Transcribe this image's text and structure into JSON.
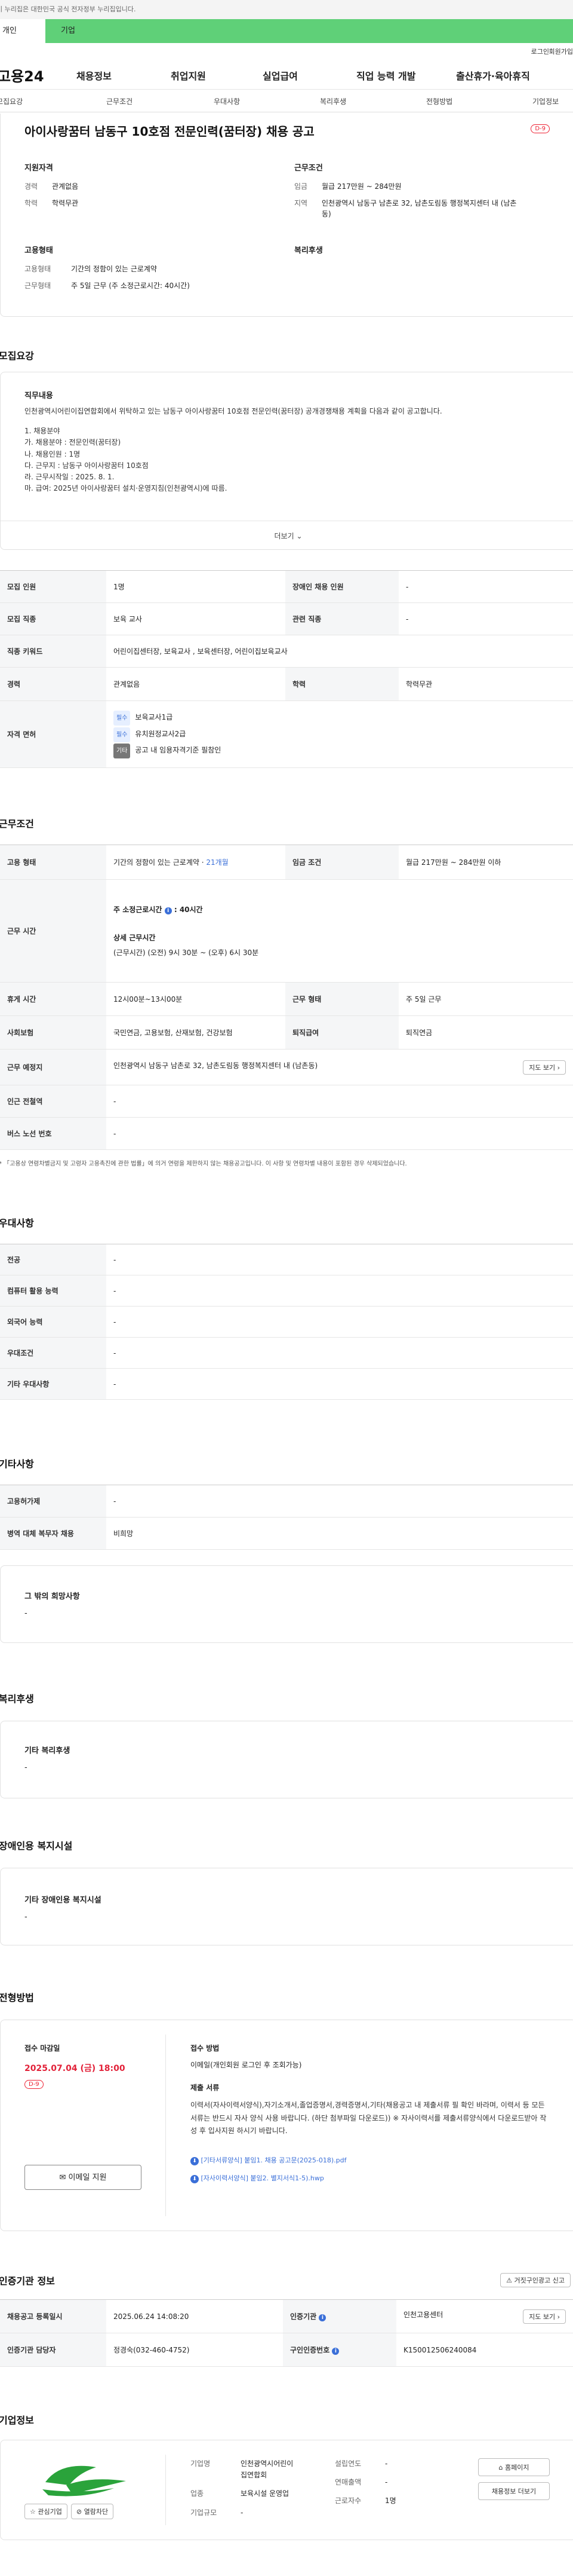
{
  "gov_notice": "이 누리집은 대한민국 공식 전자정부 누리집입니다.",
  "top_tabs": {
    "personal": "개인",
    "company": "기업"
  },
  "util": {
    "login": "로그인",
    "join": "회원가입"
  },
  "logo": "고용24",
  "gnb": [
    "채용정보",
    "취업지원",
    "실업급여",
    "직업 능력 개발",
    "출산휴가·육아휴직"
  ],
  "sub_tabs": [
    "모집요강",
    "근무조건",
    "우대사항",
    "복리후생",
    "전형방법",
    "기업정보"
  ],
  "job": {
    "title": "아이사랑꿈터 남동구 10호점 전문인력(꿈터장) 채용 공고",
    "dday": "D-9",
    "qual_title": "지원자격",
    "career_k": "경력",
    "career_v": "관계없음",
    "edu_k": "학력",
    "edu_v": "학력무관",
    "cond_title": "근무조건",
    "wage_k": "임금",
    "wage_v": "월급 217만원 ~ 284만원",
    "area_k": "지역",
    "area_v": "인천광역시 남동구 남촌로 32, 남촌도림동 행정복지센터 내 (남촌동)",
    "type_title": "고용형태",
    "emp_k": "고용형태",
    "emp_v": "기간의 정함이 있는 근로계약",
    "work_k": "근무형태",
    "work_v": "주 5일 근무 (주 소정근로시간: 40시간)",
    "welfare_title": "복리후생"
  },
  "recruit": {
    "section": "모집요강",
    "duty_title": "직무내용",
    "duty_lines": [
      "인천광역시어린이집연합회에서 위탁하고 있는 남동구 아이사랑꿈터 10호점 전문인력(꿈터장) 공개경쟁채용 계획을 다음과 같이 공고합니다.",
      "",
      "1. 채용분야",
      "가. 채용분야 : 전문인력(꿈터장)",
      "나. 채용인원 : 1명",
      "다. 근무지 : 남동구 아이사랑꿈터 10호점",
      "라. 근무시작일 : 2025. 8. 1.",
      "마. 급여: 2025년 아이사랑꿈터 설치·운영지침(인천광역시)에 따름."
    ],
    "more": "더보기",
    "rows": {
      "count_k": "모집 인원",
      "count_v": "1명",
      "disabled_k": "장애인 채용 인원",
      "disabled_v": "-",
      "field_k": "모집 직종",
      "field_v": "보육 교사",
      "rel_k": "관련 직종",
      "rel_v": "-",
      "kw_k": "직종 키워드",
      "kw_v": "어린이집센터장, 보육교사 , 보육센터장, 어린이집보육교사",
      "career_k": "경력",
      "career_v": "관계없음",
      "edu_k": "학력",
      "edu_v": "학력무관",
      "license_k": "자격 면허",
      "lic1_tag": "필수",
      "lic1": "보육교사1급",
      "lic2_tag": "필수",
      "lic2": "유치원정교사2급",
      "lic3_tag": "기타",
      "lic3": "공고 내 임용자격기준 필참인"
    }
  },
  "work": {
    "section": "근무조건",
    "emp_k": "고용 형태",
    "emp_v": "기간의 정함이 있는 근로계약 · ",
    "emp_link": "21개월",
    "wage_k": "임금 조건",
    "wage_v": "월급 217만원 ~ 284만원 이하",
    "hours_k": "근무 시간",
    "hours_week": "주 소정근로시간",
    "hours_week_v": "40시간",
    "hours_detail_t": "상세 근무시간",
    "hours_detail": "(근무시간) (오전) 9시 30분 ~ (오후) 6시 30분",
    "break_k": "휴게 시간",
    "break_v": "12시00분~13시00분",
    "form_k": "근무 형태",
    "form_v": "주 5일 근무",
    "ins_k": "사회보험",
    "ins_v": "국민연금, 고용보험, 산재보험, 건강보험",
    "sev_k": "퇴직급여",
    "sev_v": "퇴직연금",
    "place_k": "근무 예정지",
    "place_v": "인천광역시 남동구 남촌로 32, 남촌도림동 행정복지센터 내 (남촌동)",
    "map_btn": "지도 보기",
    "subway_k": "인근 전철역",
    "subway_v": "-",
    "bus_k": "버스 노선 번호",
    "bus_v": "-",
    "note": "* 「고용상 연령차별금지 및 고령자 고용촉진에 관한 법률」에 의거 연령을 제한하지 않는 채용공고입니다. 이 사항 및 연령차별 내용이 포함된 경우 삭제되었습니다."
  },
  "pref": {
    "section": "우대사항",
    "rows": [
      {
        "k": "전공",
        "v": "-"
      },
      {
        "k": "컴퓨터 활용 능력",
        "v": "-"
      },
      {
        "k": "외국어 능력",
        "v": "-"
      },
      {
        "k": "우대조건",
        "v": "-"
      },
      {
        "k": "기타 우대사항",
        "v": "-"
      }
    ]
  },
  "etc": {
    "section": "기타사항",
    "rows": [
      {
        "k": "고용허가제",
        "v": "-"
      },
      {
        "k": "병역 대체 복무자 채용",
        "v": "비희망"
      }
    ],
    "wish_title": "그 밖의 희망사항",
    "wish_v": "-"
  },
  "welfare": {
    "section": "복리후생",
    "title": "기타 복리후생",
    "v": "-"
  },
  "disability": {
    "section": "장애인용 복지시설",
    "title": "기타 장애인용 복지시설",
    "v": "-"
  },
  "process": {
    "section": "전형방법",
    "deadline_t": "접수 마감일",
    "deadline_v": "2025.07.04 (금) 18:00",
    "dday": "D-9",
    "apply_btn": "이메일 지원",
    "method_t": "접수 방법",
    "method_v": "이메일(개인회원 로그인 후 조회가능)",
    "docs_t": "제출 서류",
    "docs_v": "이력서(자사이력서양식),자기소개서,졸업증명서,경력증명서,기타(채용공고 내 제출서류 필 확인 바라며, 이력서 등 모든 서류는 반드시 자사 양식 사용 바랍니다. (하단 첨부파일 다운로드)) ※ 자사이력서를 제출서류양식에서 다운로드받아 작성 후 입사지원 하시기 바랍니다.",
    "file1": "[기타서류양식] 붙임1. 채용 공고문(2025-018).pdf",
    "file2": "[자사이력서양식] 붙임2. 별지서식1-5).hwp"
  },
  "cert": {
    "section": "인증기관 정보",
    "report_btn": "거짓구인광고 신고",
    "reg_k": "채용공고 등록일시",
    "reg_v": "2025.06.24 14:08:20",
    "org_k": "인증기관",
    "org_v": "인천고용센터",
    "map_btn": "지도 보기",
    "mgr_k": "인증기관 담당자",
    "mgr_v": "정경숙(032-460-4752)",
    "no_k": "구인인증번호",
    "no_v": "K150012506240084"
  },
  "company": {
    "section": "기업정보",
    "fav_btn": "관심기업",
    "block_btn": "열람차단",
    "name_k": "기업명",
    "name_v1": "인천광역시어린이",
    "name_v2": "집연합회",
    "ind_k": "업종",
    "ind_v": "보육시설 운영업",
    "size_k": "기업규모",
    "size_v": "-",
    "est_k": "설립연도",
    "est_v": "-",
    "sales_k": "연매출액",
    "sales_v": "-",
    "emp_k": "근로자수",
    "emp_v": "1명",
    "home_btn": "홈페이지",
    "jobs_btn": "채용정보 더보기"
  }
}
